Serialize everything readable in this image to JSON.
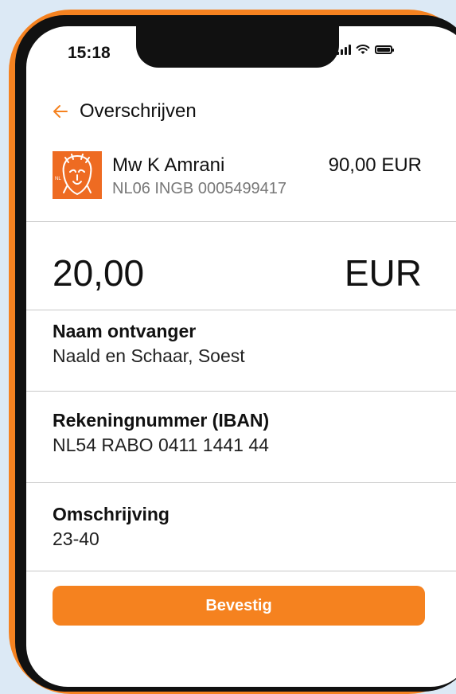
{
  "status_bar": {
    "time": "15:18"
  },
  "header": {
    "title": "Overschrijven",
    "back_icon": "arrow-left-icon"
  },
  "account": {
    "name": "Mw K Amrani",
    "balance": "90,00 EUR",
    "iban": "NL06 INGB 0005499417",
    "logo_icon": "ing-lion-logo"
  },
  "amount": {
    "value": "20,00",
    "currency": "EUR"
  },
  "fields": [
    {
      "label": "Naam ontvanger",
      "value": "Naald en Schaar, Soest"
    },
    {
      "label": "Rekeningnummer (IBAN)",
      "value": "NL54 RABO 0411 1441 44"
    },
    {
      "label": "Omschrijving",
      "value": "23-40"
    }
  ],
  "confirm_button": {
    "label": "Bevestig"
  },
  "colors": {
    "accent": "#f5821f",
    "frame": "#f58220",
    "background": "#dce9f5",
    "secondary_text": "#777777"
  }
}
